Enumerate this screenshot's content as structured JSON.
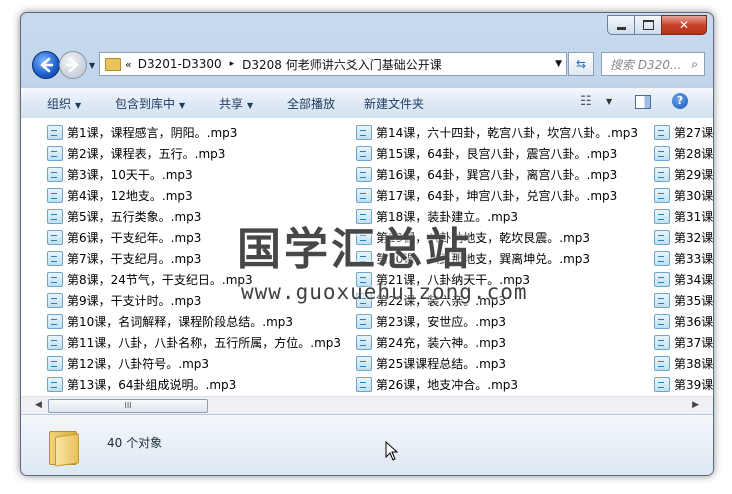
{
  "window": {
    "address": {
      "chevron": "«",
      "crumbs": [
        "D3201-D3300",
        "D3208 何老师讲六爻入门基础公开课"
      ],
      "separator": "▸"
    },
    "search_placeholder": "搜索 D320...",
    "caption_buttons": [
      "minimize-icon",
      "maximize-icon",
      "close-icon"
    ]
  },
  "toolbar": {
    "organize": "组织",
    "include_in_library": "包含到库中",
    "share": "共享",
    "play_all": "全部播放",
    "new_folder": "新建文件夹"
  },
  "files": {
    "col1": [
      "第1课，课程感言，阴阳。.mp3",
      "第2课，课程表，五行。.mp3",
      "第3课，10天干。.mp3",
      "第4课，12地支。.mp3",
      "第5课，五行类象。.mp3",
      "第6课，干支纪年。.mp3",
      "第7课，干支纪月。.mp3",
      "第8课，24节气，干支纪日。.mp3",
      "第9课，干支计时。.mp3",
      "第10课，名词解释，课程阶段总结。.mp3",
      "第11课，八卦，八卦名称，五行所属，方位。.mp3",
      "第12课，八卦符号。.mp3",
      "第13课，64卦组成说明。.mp3"
    ],
    "col2": [
      "第14课，六十四卦，乾宫八卦，坎宫八卦。.mp3",
      "第15课，64卦，艮宫八卦，震宫八卦。.mp3",
      "第16课，64卦，巽宫八卦，离宫八卦。.mp3",
      "第17课，64卦，坤宫八卦，兑宫八卦。.mp3",
      "第18课，装卦建立。.mp3",
      "第19课，八卦纳地支，乾坎艮震。.mp3",
      "第20课，八卦那地支，巽离坤兑。.mp3",
      "第21课，八卦纳天干。.mp3",
      "第22课，装六亲。.mp3",
      "第23课，安世应。.mp3",
      "第24充，装六神。.mp3",
      "第25课课程总结。.mp3",
      "第26课，地支冲合。.mp3"
    ],
    "col3": [
      "第27课",
      "第28课",
      "第29课",
      "第30课",
      "第31课",
      "第32课",
      "第33课",
      "第34课",
      "第35课",
      "第36课",
      "第37课",
      "第38课",
      "第39课"
    ]
  },
  "watermark": {
    "title": "国学汇总站",
    "url": "www.guoxuehuizong.com"
  },
  "scrollbar": {
    "thumb_grip": "III"
  },
  "status": {
    "item_count": "40 个对象"
  }
}
